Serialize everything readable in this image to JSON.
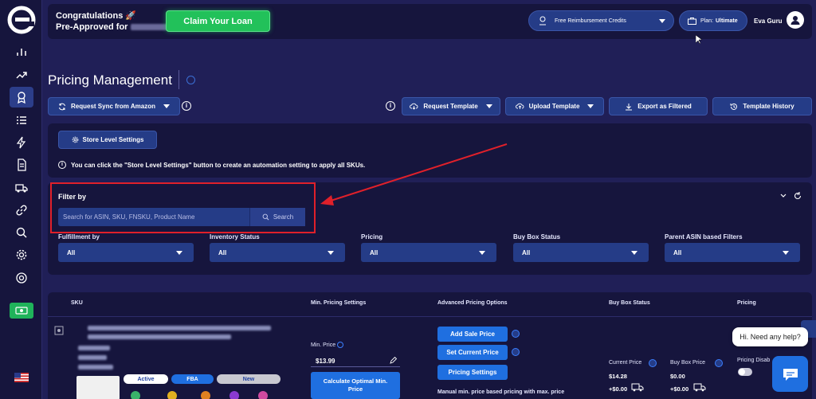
{
  "sidebar": {
    "logo": "e",
    "icons": [
      "bar-chart-icon",
      "trend-icon",
      "award-icon",
      "list-icon",
      "bolt-icon",
      "document-icon",
      "truck-icon",
      "link-icon",
      "search-icon",
      "settings-icon",
      "support-icon",
      "money-icon",
      "flag-us-icon"
    ]
  },
  "topbar": {
    "congrats_line1": "Congratulations 🚀",
    "congrats_line2": "Pre-Approved for",
    "claim_button": "Claim Your Loan",
    "reimbursement": "Free Reimbursement Credits",
    "plan_label": "Plan:",
    "plan_value": "Ultimate",
    "user_name": "Eva Guru"
  },
  "page": {
    "title": "Pricing Management"
  },
  "actions": {
    "request_sync": "Request Sync from Amazon",
    "request_template": "Request Template",
    "upload_template": "Upload Template",
    "export_filtered": "Export as Filtered",
    "template_history": "Template History"
  },
  "store": {
    "button": "Store Level Settings",
    "note": "You can click the \"Store Level Settings\" button to create an automation setting to apply all SKUs."
  },
  "filter": {
    "title": "Filter by",
    "search_placeholder": "Search for ASIN, SKU, FNSKU, Product Name",
    "search_button": "Search",
    "dropdowns": [
      {
        "label": "Fulfillment by",
        "value": "All"
      },
      {
        "label": "Inventory Status",
        "value": "All"
      },
      {
        "label": "Pricing",
        "value": "All"
      },
      {
        "label": "Buy Box Status",
        "value": "All"
      },
      {
        "label": "Parent ASIN based Filters",
        "value": "All"
      }
    ]
  },
  "table": {
    "headers": [
      "SKU",
      "Min. Pricing Settings",
      "Advanced Pricing Options",
      "Buy Box Status",
      "Pricing"
    ],
    "row": {
      "pills": [
        "Active",
        "FBA",
        "New"
      ],
      "min_price_label": "Min. Price",
      "min_price_value": "$13.99",
      "calc_button": "Calculate Optimal Min. Price",
      "adv_buttons": [
        "Add Sale Price",
        "Set Current Price",
        "Pricing Settings"
      ],
      "adv_note": "Manual min. price based pricing with max. price",
      "current_price_label": "Current Price",
      "current_price": "$14.28",
      "current_shipping": "+$0.00",
      "buybox_price_label": "Buy Box Price",
      "buybox_price": "$0.00",
      "buybox_shipping": "+$0.00",
      "pricing_status": "Pricing Disab"
    }
  },
  "chat": {
    "bubble": "Hi. Need any help?"
  },
  "colors": {
    "background": "#201f57",
    "panel": "#16153d",
    "button": "#253c87",
    "accent_blue": "#1f6fe0",
    "claim_green": "#22c15a",
    "annotation_red": "#e0202a"
  }
}
